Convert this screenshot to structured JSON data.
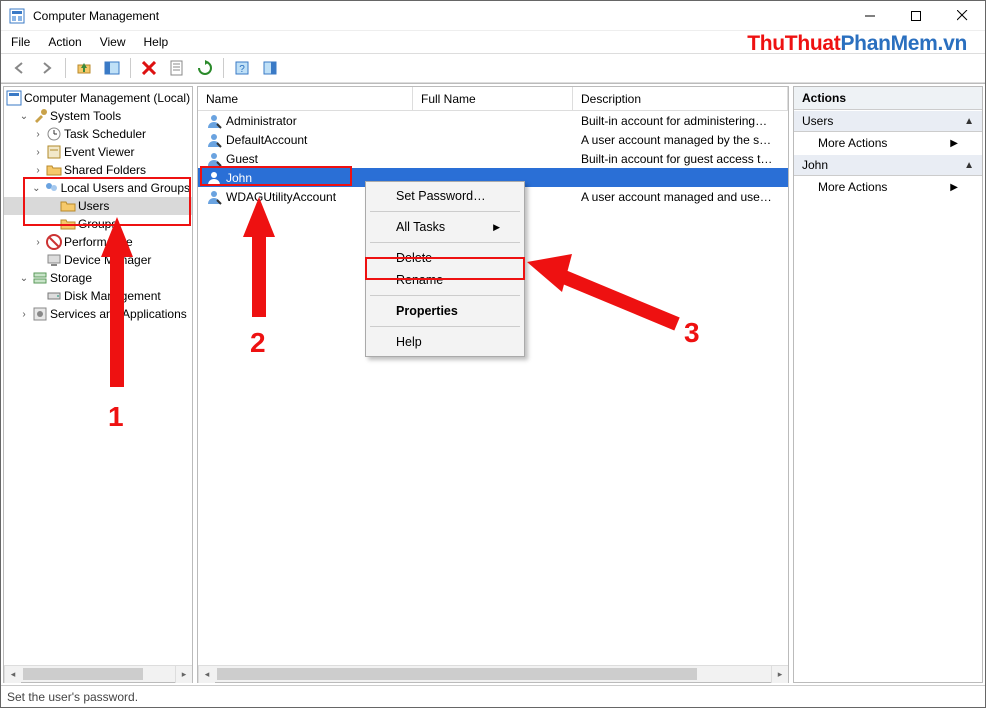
{
  "window": {
    "title": "Computer Management",
    "menus": [
      "File",
      "Action",
      "View",
      "Help"
    ],
    "status": "Set the user's password."
  },
  "watermark": {
    "part1": "ThuThuat",
    "part2": "PhanMem",
    "part3": ".vn"
  },
  "tree": {
    "root": "Computer Management (Local)",
    "system_tools": "System Tools",
    "task_scheduler": "Task Scheduler",
    "event_viewer": "Event Viewer",
    "shared_folders": "Shared Folders",
    "local_users": "Local Users and Groups",
    "users": "Users",
    "groups": "Groups",
    "performance": "Performance",
    "device_manager": "Device Manager",
    "storage": "Storage",
    "disk_management": "Disk Management",
    "services_apps": "Services and Applications"
  },
  "list": {
    "headers": {
      "name": "Name",
      "full": "Full Name",
      "desc": "Description"
    },
    "rows": [
      {
        "name": "Administrator",
        "full": "",
        "desc": "Built-in account for administering…"
      },
      {
        "name": "DefaultAccount",
        "full": "",
        "desc": "A user account managed by the s…"
      },
      {
        "name": "Guest",
        "full": "",
        "desc": "Built-in account for guest access t…"
      },
      {
        "name": "John",
        "full": "",
        "desc": ""
      },
      {
        "name": "WDAGUtilityAccount",
        "full": "",
        "desc": "A user account managed and use…"
      }
    ]
  },
  "context_menu": {
    "set_password": "Set Password…",
    "all_tasks": "All Tasks",
    "delete": "Delete",
    "rename": "Rename",
    "properties": "Properties",
    "help": "Help"
  },
  "actions": {
    "title": "Actions",
    "sections": [
      {
        "label": "Users",
        "items": [
          "More Actions"
        ]
      },
      {
        "label": "John",
        "items": [
          "More Actions"
        ]
      }
    ]
  },
  "annotations": {
    "n1": "1",
    "n2": "2",
    "n3": "3"
  }
}
